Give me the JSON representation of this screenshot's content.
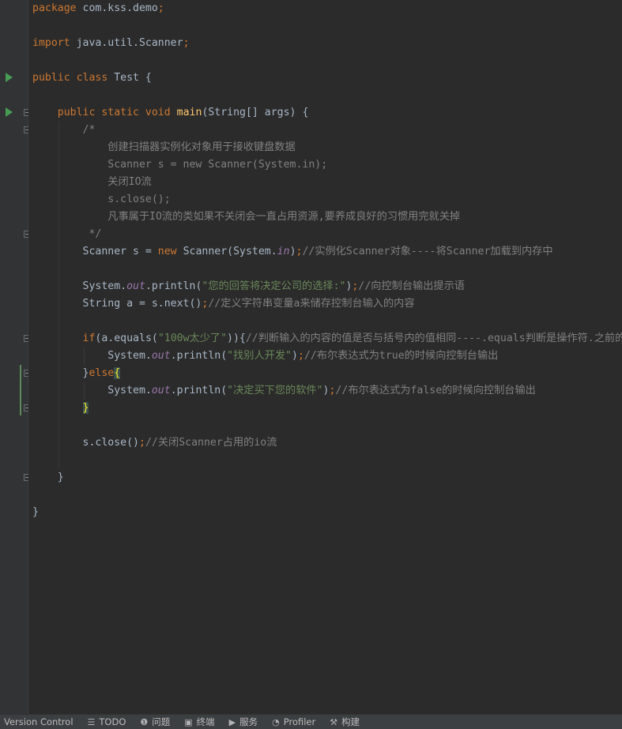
{
  "code": {
    "lines": [
      [
        {
          "t": "package",
          "c": "kw"
        },
        {
          "t": " com.kss.demo"
        },
        {
          "t": ";",
          "c": "kw"
        }
      ],
      [],
      [
        {
          "t": "import",
          "c": "kw"
        },
        {
          "t": " java.util.Scanner"
        },
        {
          "t": ";",
          "c": "kw"
        }
      ],
      [],
      [
        {
          "t": "public class",
          "c": "kw"
        },
        {
          "t": " Test {"
        }
      ],
      [],
      [
        {
          "t": "    "
        },
        {
          "t": "public static void",
          "c": "kw"
        },
        {
          "t": " "
        },
        {
          "t": "main",
          "c": "fn"
        },
        {
          "t": "(String[] args) {"
        }
      ],
      [
        {
          "t": "        /*",
          "c": "cm"
        }
      ],
      [
        {
          "t": "            创建扫描器实例化对象用于接收键盘数据",
          "c": "cm"
        }
      ],
      [
        {
          "t": "            Scanner s = new Scanner(System.in);",
          "c": "cm"
        }
      ],
      [
        {
          "t": "            关闭IO流",
          "c": "cm"
        }
      ],
      [
        {
          "t": "            s.close();",
          "c": "cm"
        }
      ],
      [
        {
          "t": "            凡事属于IO流的类如果不关闭会一直占用资源,要养成良好的习惯用完就关掉",
          "c": "cm"
        }
      ],
      [
        {
          "t": "         */",
          "c": "cm"
        }
      ],
      [
        {
          "t": "        Scanner s = "
        },
        {
          "t": "new",
          "c": "kw"
        },
        {
          "t": " Scanner(System."
        },
        {
          "t": "in",
          "c": "fld"
        },
        {
          "t": ")"
        },
        {
          "t": ";",
          "c": "kw"
        },
        {
          "t": "//实例化Scanner对象----将Scanner加载到内存中",
          "c": "cm"
        }
      ],
      [],
      [
        {
          "t": "        System."
        },
        {
          "t": "out",
          "c": "fld"
        },
        {
          "t": ".println("
        },
        {
          "t": "\"您的回答将决定公司的选择:\"",
          "c": "str"
        },
        {
          "t": ")"
        },
        {
          "t": ";",
          "c": "kw"
        },
        {
          "t": "//向控制台输出提示语",
          "c": "cm"
        }
      ],
      [
        {
          "t": "        String a = s.next()"
        },
        {
          "t": ";",
          "c": "kw"
        },
        {
          "t": "//定义字符串变量a来储存控制台输入的内容",
          "c": "cm"
        }
      ],
      [],
      [
        {
          "t": "        "
        },
        {
          "t": "if",
          "c": "kw"
        },
        {
          "t": "(a.equals("
        },
        {
          "t": "\"100w太少了\"",
          "c": "str"
        },
        {
          "t": ")){"
        },
        {
          "t": "//判断输入的内容的值是否与括号内的值相同----.equals判断是操作符.之前的",
          "c": "cm"
        }
      ],
      [
        {
          "t": "            System."
        },
        {
          "t": "out",
          "c": "fld"
        },
        {
          "t": ".println("
        },
        {
          "t": "\"找别人开发\"",
          "c": "str"
        },
        {
          "t": ")"
        },
        {
          "t": ";",
          "c": "kw"
        },
        {
          "t": "//布尔表达式为true的时候向控制台输出",
          "c": "cm"
        }
      ],
      [
        {
          "t": "        }"
        },
        {
          "t": "else",
          "c": "kw"
        },
        {
          "t": "{",
          "c": "brace-hl"
        }
      ],
      [
        {
          "t": "            System."
        },
        {
          "t": "out",
          "c": "fld"
        },
        {
          "t": ".println("
        },
        {
          "t": "\"决定买下您的软件\"",
          "c": "str"
        },
        {
          "t": ")"
        },
        {
          "t": ";",
          "c": "kw"
        },
        {
          "t": "//布尔表达式为false的时候向控制台输出",
          "c": "cm"
        }
      ],
      [
        {
          "t": "        "
        },
        {
          "t": "}",
          "c": "brace-hl"
        }
      ],
      [],
      [
        {
          "t": "        s.close()"
        },
        {
          "t": ";",
          "c": "kw"
        },
        {
          "t": "//关闭Scanner占用的io流",
          "c": "cm"
        }
      ],
      [],
      [
        {
          "t": "    }"
        }
      ],
      [],
      [
        {
          "t": "}"
        }
      ]
    ]
  },
  "statusbar": {
    "version_control": "Version Control",
    "todo": "TODO",
    "problems": "问题",
    "terminal": "终端",
    "services": "服务",
    "profiler": "Profiler",
    "build": "构建"
  },
  "icons": {
    "run": "run-icon",
    "fold": "fold-icon",
    "todo": "list-icon",
    "problems": "info-icon",
    "terminal": "terminal-icon",
    "services": "play-icon",
    "profiler": "profiler-icon",
    "build": "hammer-icon"
  },
  "colors": {
    "background": "#2b2b2b",
    "keyword": "#cc7832",
    "string": "#6a8759",
    "comment": "#808080",
    "method": "#ffc66d",
    "static_field": "#9876aa",
    "text": "#a9b7c6"
  }
}
